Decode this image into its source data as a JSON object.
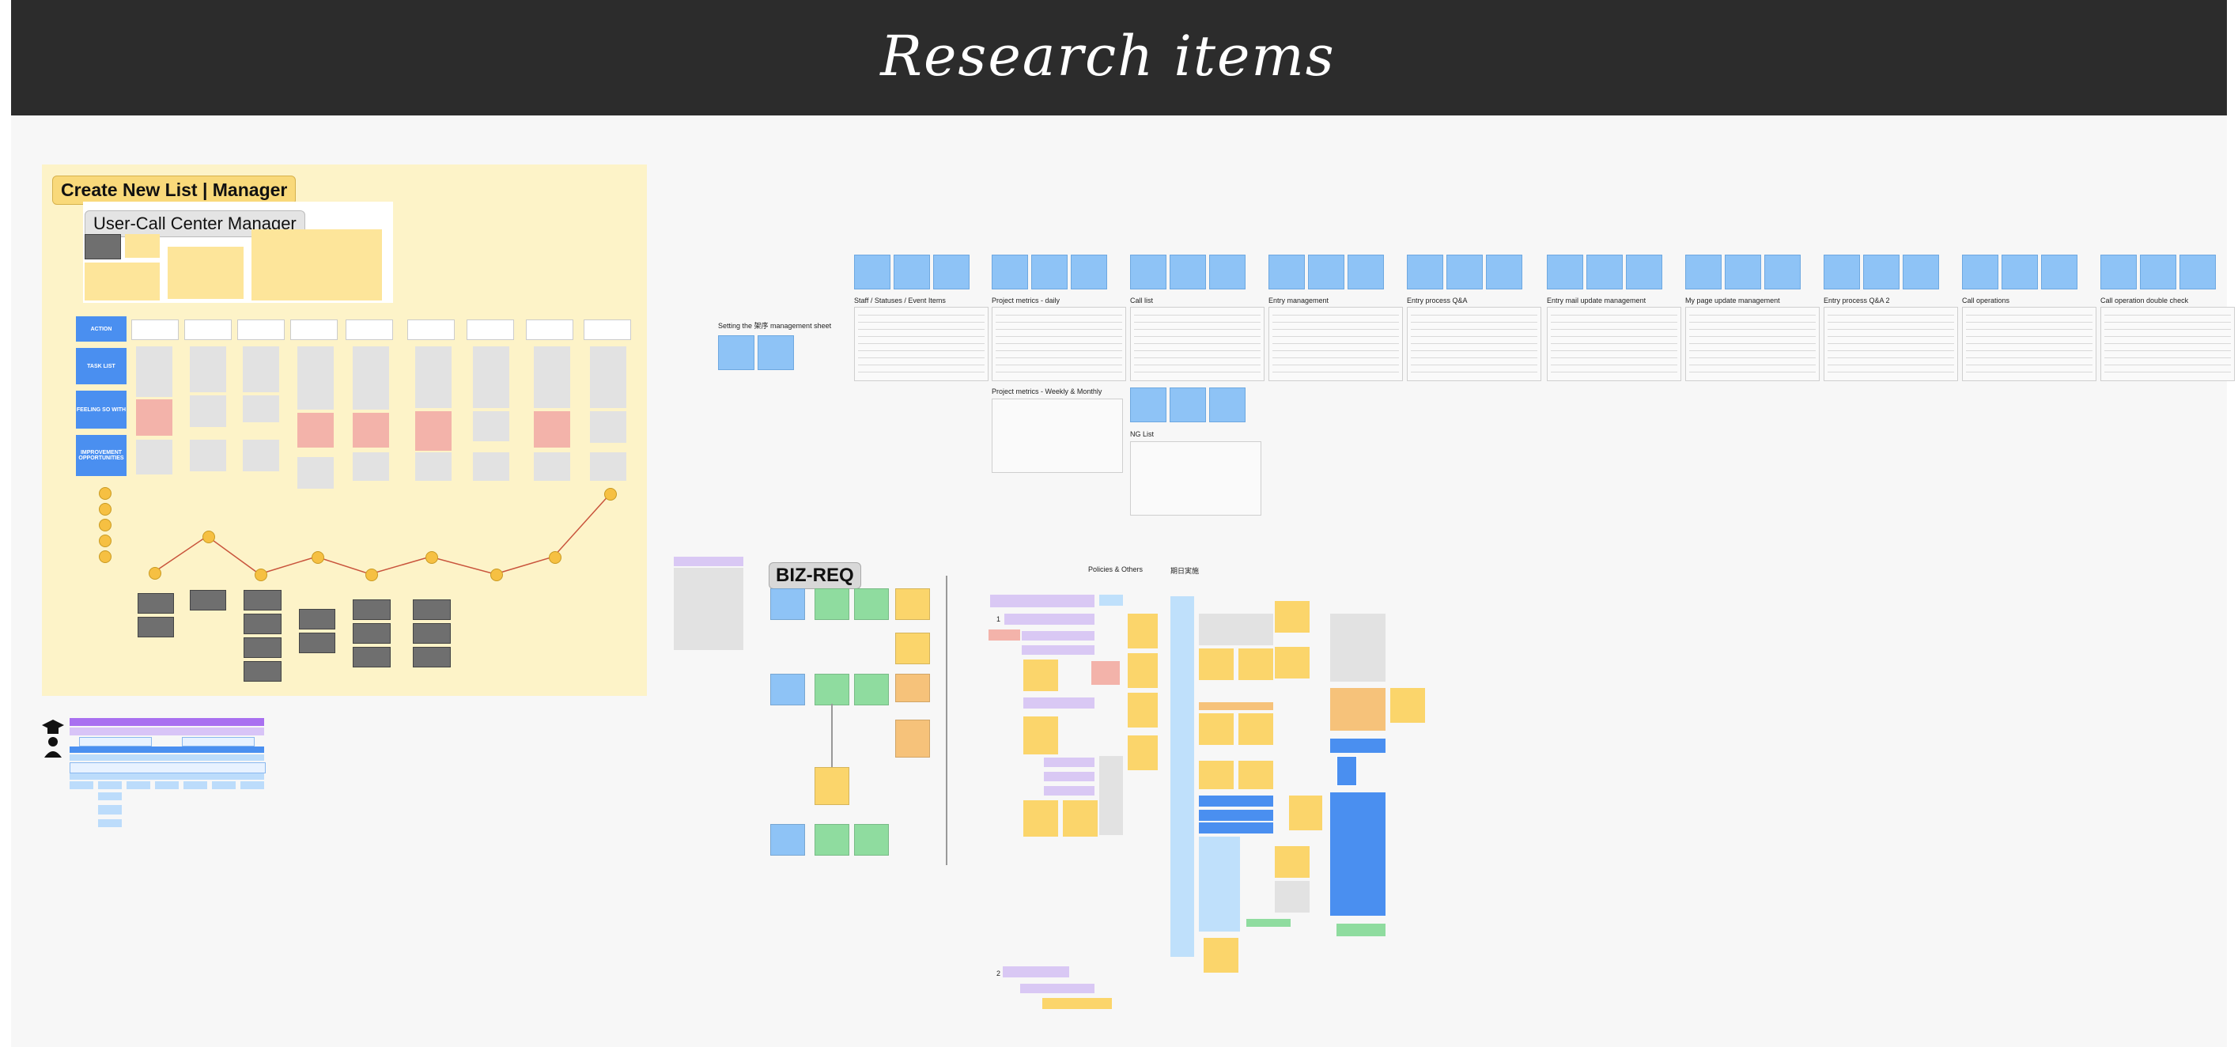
{
  "banner": {
    "title": "Research items"
  },
  "journey_map": {
    "tag": "Create New List | Manager",
    "persona_title": "User-Call Center Manager",
    "row_headers": [
      "ACTION",
      "TASK LIST",
      "FEELING SO WITH",
      "IMPROVEMENT OPPORTUNITIES"
    ]
  },
  "sheets": {
    "labels": [
      "Staff / Statuses / Event Items",
      "Project metrics - daily",
      "Call list",
      "Entry management",
      "Entry process Q&A",
      "Entry mail update management",
      "My page update management",
      "Entry process Q&A 2",
      "Call operations",
      "Call operation double check"
    ],
    "weekly_label": "Project metrics - Weekly & Monthly",
    "ng_label": "NG List",
    "setting_label": "Setting the 架序 management sheet"
  },
  "biz_req": {
    "title": "BIZ-REQ",
    "header_left": "Policies & Others",
    "header_right": "期日実施",
    "marker_1": "1",
    "marker_2": "2"
  },
  "icons": [
    "graduation-cap-icon",
    "person-icon"
  ],
  "colors": {
    "banner": "#2c2c2c",
    "journey_bg": "#fdf3c8",
    "sticky_blue": "#8ec3f6",
    "sticky_yellow": "#fbd56b",
    "sticky_green": "#8fdc9f",
    "accent_blue": "#4a8ff0"
  }
}
